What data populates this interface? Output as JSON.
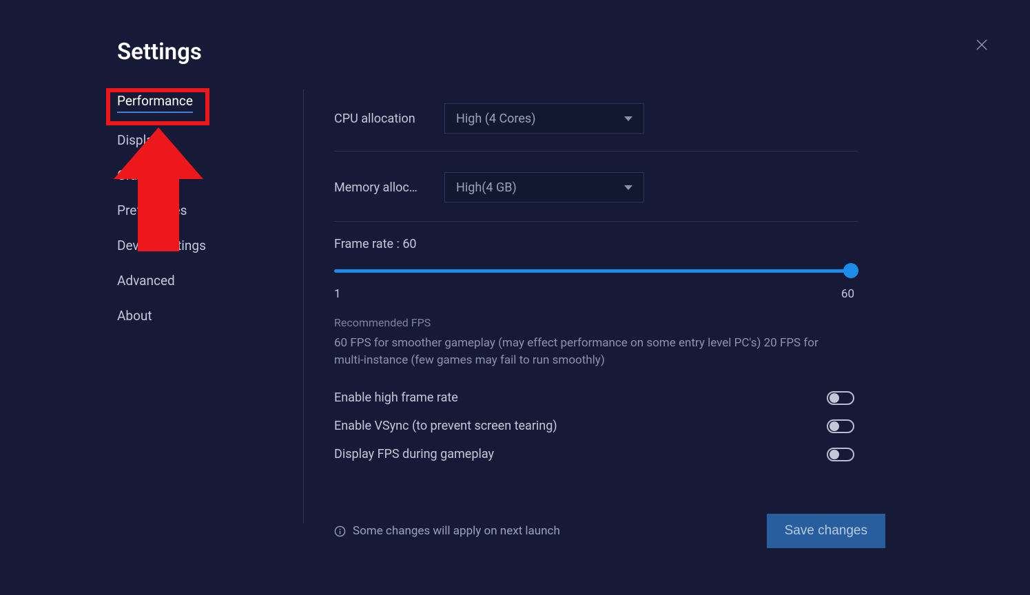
{
  "title": "Settings",
  "sidebar": {
    "items": [
      {
        "label": "Performance",
        "active": true
      },
      {
        "label": "Display",
        "active": false
      },
      {
        "label": "Graphics",
        "active": false
      },
      {
        "label": "Preferences",
        "active": false
      },
      {
        "label": "Device settings",
        "active": false
      },
      {
        "label": "Advanced",
        "active": false
      },
      {
        "label": "About",
        "active": false
      }
    ]
  },
  "main": {
    "cpu": {
      "label": "CPU allocation",
      "value": "High (4 Cores)"
    },
    "memory": {
      "label": "Memory alloc…",
      "value": "High(4 GB)"
    },
    "framerate": {
      "label": "Frame rate : 60",
      "min": "1",
      "max": "60"
    },
    "recommended": {
      "title": "Recommended FPS",
      "description": "60 FPS for smoother gameplay (may effect performance on some entry level PC's) 20 FPS for multi-instance (few games may fail to run smoothly)"
    },
    "toggles": {
      "highframerate": "Enable high frame rate",
      "vsync": "Enable VSync (to prevent screen tearing)",
      "displayfps": "Display FPS during gameplay"
    }
  },
  "footer": {
    "note": "Some changes will apply on next launch",
    "save": "Save changes"
  }
}
